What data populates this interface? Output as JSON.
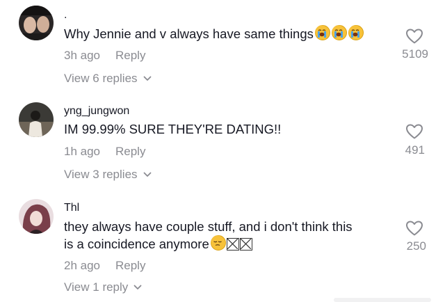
{
  "comments": [
    {
      "username": ".",
      "text": "Why Jennie and v always have same things",
      "time": "3h ago",
      "reply_label": "Reply",
      "likes": "5109",
      "view_replies": "View 6 replies",
      "emojis": [
        "loudly-crying-face",
        "loudly-crying-face",
        "loudly-crying-face"
      ]
    },
    {
      "username": "yng_jungwon",
      "text": "IM 99.99% SURE THEY'RE DATING!!",
      "time": "1h ago",
      "reply_label": "Reply",
      "likes": "491",
      "view_replies": "View 3 replies"
    },
    {
      "username": "Thl",
      "text_line1": "they always have couple stuff, and i don't think this",
      "text_line2": "is a coincidence anymore",
      "time": "2h ago",
      "reply_label": "Reply",
      "likes": "250",
      "view_replies": "View 1 reply",
      "emojis": [
        "pensive-face",
        "missing-glyph-box",
        "missing-glyph-box"
      ]
    }
  ],
  "colors": {
    "text": "#161823",
    "secondary": "#8a8b91",
    "heart": "#8a8b91"
  }
}
